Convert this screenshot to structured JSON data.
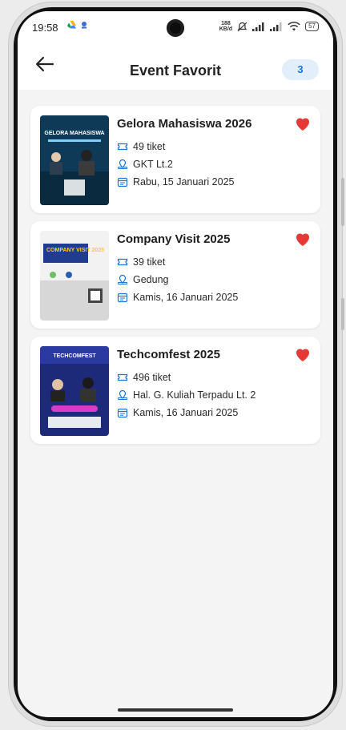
{
  "status": {
    "time": "19:58",
    "speed_top": "188",
    "speed_bottom": "KB/d",
    "battery": "57"
  },
  "header": {
    "title": "Event Favorit",
    "count": "3"
  },
  "events": [
    {
      "title": "Gelora Mahasiswa 2026",
      "tickets": "49 tiket",
      "location": "GKT Lt.2",
      "date": "Rabu, 15 Januari 2025",
      "poster_text": "GELORA MAHASISWA"
    },
    {
      "title": "Company Visit 2025",
      "tickets": "39 tiket",
      "location": "Gedung",
      "date": "Kamis, 16 Januari 2025",
      "poster_text": "COMPANY VISIT 2025"
    },
    {
      "title": "Techcomfest 2025",
      "tickets": "496 tiket",
      "location": "Hal. G. Kuliah Terpadu Lt. 2",
      "date": "Kamis, 16 Januari 2025",
      "poster_text": "TECHCOMFEST"
    }
  ],
  "colors": {
    "heart": "#e53935",
    "accent": "#1f73d6",
    "icon": "#1f73d6"
  }
}
